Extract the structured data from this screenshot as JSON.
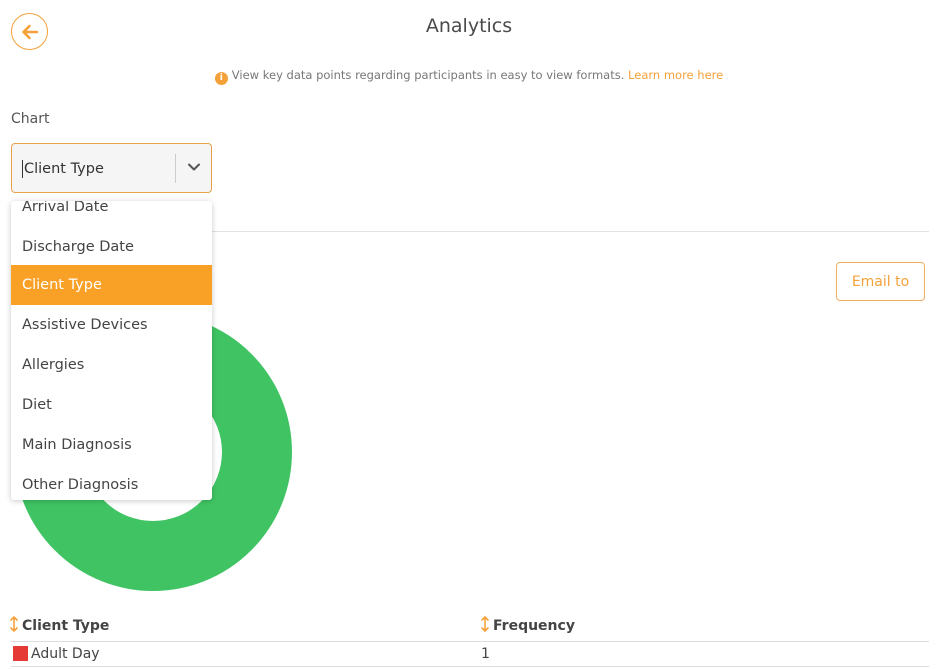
{
  "header": {
    "title": "Analytics",
    "info_text": "View key data points regarding participants in easy to view formats.",
    "learn_more": "Learn more here"
  },
  "chart_selector": {
    "label": "Chart",
    "selected": "Client Type",
    "options": [
      "Arrival Date",
      "Discharge Date",
      "Client Type",
      "Assistive Devices",
      "Allergies",
      "Diet",
      "Main Diagnosis",
      "Other Diagnosis"
    ]
  },
  "actions": {
    "email_label": "Email to"
  },
  "table": {
    "columns": [
      "Client Type",
      "Frequency"
    ],
    "rows": [
      {
        "client_type": "Adult Day",
        "frequency": "1",
        "color": "#e53935"
      }
    ]
  },
  "colors": {
    "accent": "#f5a13a",
    "selected_option_bg": "#f9a126",
    "donut_color": "#40c463"
  },
  "icons": {
    "back": "back-arrow-icon",
    "info": "info-icon",
    "chevron": "chevron-down-icon",
    "sort": "sort-arrows-icon"
  }
}
